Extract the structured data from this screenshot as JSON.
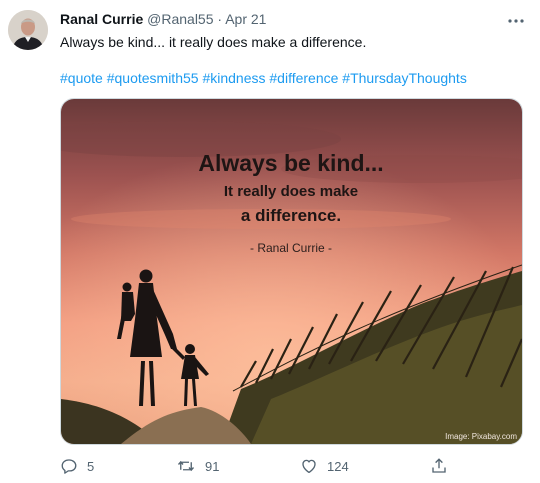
{
  "tweet": {
    "author_name": "Ranal Currie",
    "handle": "@Ranal55",
    "separator": "·",
    "date": "Apr 21",
    "text": "Always be kind... it really does make a difference.",
    "hashtags": [
      "#quote",
      "#quotesmith55",
      "#kindness",
      "#difference",
      "#ThursdayThoughts"
    ]
  },
  "image": {
    "headline": "Always be kind...",
    "line2": "It really does make",
    "line3": "a difference.",
    "attribution": "- Ranal Currie -",
    "credit": "Image: Pixabay.com"
  },
  "actions": {
    "replies": "5",
    "retweets": "91",
    "likes": "124"
  },
  "colors": {
    "link": "#1d9bf0",
    "secondary_text": "#536471",
    "sky_top": "#6a3a3a",
    "sky_glow": "#f19a7f"
  },
  "icons": [
    "more-icon",
    "reply-icon",
    "retweet-icon",
    "like-icon",
    "share-icon"
  ]
}
